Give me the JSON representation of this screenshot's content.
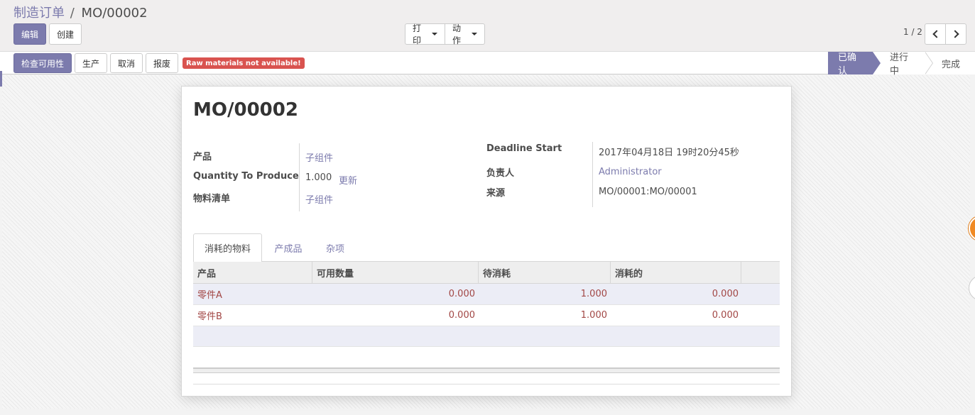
{
  "breadcrumb": {
    "parent": "制造订单",
    "separator": "/",
    "current": "MO/00002"
  },
  "toolbar": {
    "edit_label": "编辑",
    "create_label": "创建",
    "print_label": "打印",
    "action_label": "动作"
  },
  "pager": {
    "value": "1 / 2"
  },
  "statusbar": {
    "buttons": [
      "检查可用性",
      "生产",
      "取消",
      "报废"
    ],
    "error_badge": "Raw materials not available!",
    "stages": [
      "已确认",
      "进行中",
      "完成"
    ],
    "active_stage": "已确认"
  },
  "form": {
    "title": "MO/00002",
    "product_label": "产品",
    "product_value": "子组件",
    "qty_label": "Quantity To Produce",
    "qty_value": "1.000",
    "qty_update": "更新",
    "bom_label": "物料清单",
    "bom_value": "子组件",
    "deadline_label": "Deadline Start",
    "deadline_value": "2017年04月18日 19时20分45秒",
    "responsible_label": "负责人",
    "responsible_value": "Administrator",
    "source_label": "来源",
    "source_value": "MO/00001:MO/00001"
  },
  "tabs": [
    "消耗的物料",
    "产成品",
    "杂项"
  ],
  "table": {
    "headers": [
      "产品",
      "可用数量",
      "待消耗",
      "消耗的"
    ],
    "rows": [
      {
        "product": "零件A",
        "available": "0.000",
        "to_consume": "1.000",
        "consumed": "0.000"
      },
      {
        "product": "零件B",
        "available": "0.000",
        "to_consume": "1.000",
        "consumed": "0.000"
      }
    ]
  },
  "colors": {
    "primary": "#7c7bad",
    "danger": "#d9534f",
    "row_text": "#a24745"
  }
}
